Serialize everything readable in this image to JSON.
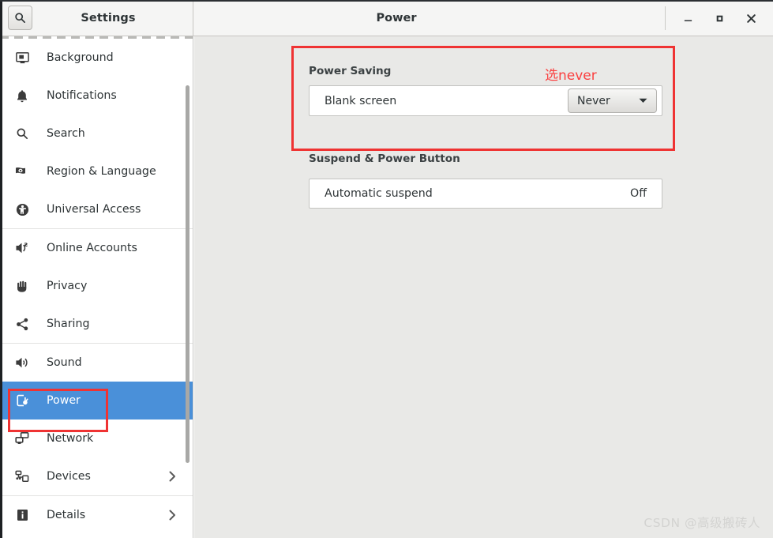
{
  "window": {
    "sidebar_title": "Settings",
    "content_title": "Power",
    "search_icon": "search-icon",
    "controls": {
      "minimize": "_",
      "maximize": "□",
      "close": "✕"
    }
  },
  "sidebar": {
    "groups": [
      {
        "items": [
          {
            "label": "Background",
            "icon": "monitor-wallpaper-icon",
            "selected": false,
            "chevron": false
          },
          {
            "label": "Notifications",
            "icon": "bell-icon",
            "selected": false,
            "chevron": false
          },
          {
            "label": "Search",
            "icon": "search-icon",
            "selected": false,
            "chevron": false
          },
          {
            "label": "Region & Language",
            "icon": "flag-icon",
            "selected": false,
            "chevron": false
          },
          {
            "label": "Universal Access",
            "icon": "accessibility-icon",
            "selected": false,
            "chevron": false
          }
        ]
      },
      {
        "items": [
          {
            "label": "Online Accounts",
            "icon": "online-accounts-icon",
            "selected": false,
            "chevron": false
          },
          {
            "label": "Privacy",
            "icon": "hand-icon",
            "selected": false,
            "chevron": false
          },
          {
            "label": "Sharing",
            "icon": "share-icon",
            "selected": false,
            "chevron": false
          }
        ]
      },
      {
        "items": [
          {
            "label": "Sound",
            "icon": "speaker-icon",
            "selected": false,
            "chevron": false
          },
          {
            "label": "Power",
            "icon": "power-plug-icon",
            "selected": true,
            "chevron": false
          },
          {
            "label": "Network",
            "icon": "network-icon",
            "selected": false,
            "chevron": false
          },
          {
            "label": "Devices",
            "icon": "devices-icon",
            "selected": false,
            "chevron": true
          }
        ]
      },
      {
        "items": [
          {
            "label": "Details",
            "icon": "info-icon",
            "selected": false,
            "chevron": true
          }
        ]
      }
    ]
  },
  "main": {
    "power_saving": {
      "title": "Power Saving",
      "rows": [
        {
          "label": "Blank screen",
          "value": "Never",
          "control": "dropdown"
        }
      ]
    },
    "suspend_power_button": {
      "title": "Suspend & Power Button",
      "rows": [
        {
          "label": "Automatic suspend",
          "value": "Off",
          "control": "text"
        }
      ]
    },
    "annotation": "选never"
  },
  "watermark": "CSDN @高级搬砖人",
  "colors": {
    "accent_selection": "#4a90d9",
    "annotation_red": "#fa4040",
    "highlight_box_red": "#ef3333",
    "content_bg": "#e9e9e7",
    "titlebar_bg": "#f5f5f4"
  }
}
